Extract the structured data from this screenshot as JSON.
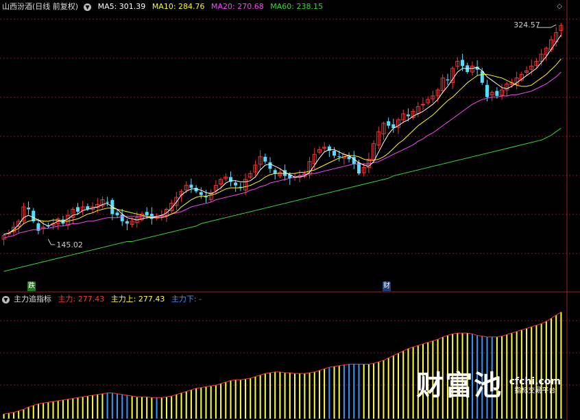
{
  "header": {
    "title": "山西汾酒(日线 前复权)",
    "ma5": "MA5: 301.39",
    "ma10": "MA10: 284.76",
    "ma20": "MA20: 270.68",
    "ma60": "MA60: 238.15"
  },
  "indicator_header": {
    "name": "主力追指标",
    "main": "主力: 277.43",
    "up": "主力上: 277.43",
    "down": "主力下: -"
  },
  "markers": {
    "left": "跌",
    "right": "财"
  },
  "watermark": {
    "big": "财富池",
    "site": "cfchi.com",
    "sub": "指标交易平台"
  },
  "colors": {
    "ma5": "#ffffff",
    "ma10": "#ffff00",
    "ma20": "#ff44ff",
    "ma60": "#33dd33",
    "up": "#ff3333",
    "down": "#55ddff",
    "bar_up": "#ffff33",
    "bar_down": "#3399ff",
    "grid": "#8a1a1a"
  },
  "chart_data": [
    {
      "type": "candlestick",
      "title": "山西汾酒(日线 前复权)",
      "annotations": [
        {
          "label": "324.57",
          "x": 112,
          "y": 324.57
        },
        {
          "label": "145.02",
          "x": 9,
          "y": 145.02
        }
      ],
      "ylim": [
        110,
        335
      ],
      "x_count": 114,
      "closes": [
        148,
        150,
        155,
        160,
        172,
        170,
        160,
        152,
        155,
        156,
        158,
        162,
        158,
        165,
        170,
        168,
        172,
        170,
        172,
        174,
        178,
        176,
        166,
        165,
        160,
        158,
        160,
        163,
        166,
        165,
        162,
        164,
        165,
        170,
        175,
        180,
        185,
        190,
        188,
        185,
        182,
        180,
        184,
        190,
        195,
        197,
        193,
        190,
        188,
        195,
        200,
        207,
        214,
        210,
        204,
        200,
        201,
        198,
        196,
        197,
        198,
        200,
        210,
        216,
        220,
        222,
        219,
        215,
        214,
        216,
        212,
        208,
        200,
        205,
        212,
        225,
        235,
        242,
        240,
        238,
        245,
        250,
        248,
        252,
        256,
        258,
        262,
        265,
        270,
        280,
        278,
        288,
        294,
        290,
        285,
        290,
        287,
        276,
        264,
        268,
        265,
        270,
        275,
        276,
        280,
        283,
        286,
        290,
        294,
        300,
        305,
        312,
        318,
        324
      ],
      "ma5": [
        149,
        150,
        153,
        157,
        163,
        165,
        163,
        161,
        158,
        156,
        158,
        160,
        160,
        162,
        165,
        166,
        169,
        170,
        171,
        172,
        174,
        175,
        172,
        170,
        166,
        163,
        162,
        161,
        162,
        163,
        163,
        164,
        165,
        167,
        171,
        176,
        182,
        185,
        187,
        187,
        186,
        184,
        183,
        185,
        188,
        192,
        194,
        194,
        193,
        193,
        194,
        197,
        203,
        207,
        208,
        206,
        204,
        201,
        199,
        197,
        197,
        198,
        201,
        207,
        213,
        218,
        220,
        220,
        218,
        216,
        215,
        212,
        209,
        207,
        206,
        210,
        218,
        226,
        233,
        238,
        240,
        243,
        245,
        248,
        250,
        252,
        255,
        258,
        262,
        268,
        273,
        279,
        285,
        288,
        288,
        288,
        289,
        286,
        281,
        278,
        275,
        272,
        271,
        273,
        276,
        279,
        282,
        285,
        288,
        293,
        298,
        304,
        310,
        316
      ],
      "ma10": [
        149,
        150,
        152,
        154,
        158,
        160,
        161,
        161,
        160,
        160,
        161,
        161,
        160,
        160,
        161,
        162,
        164,
        166,
        167,
        169,
        170,
        171,
        171,
        170,
        169,
        168,
        167,
        166,
        165,
        164,
        163,
        163,
        163,
        164,
        166,
        168,
        172,
        175,
        178,
        180,
        181,
        181,
        182,
        183,
        185,
        187,
        188,
        188,
        188,
        189,
        190,
        192,
        194,
        197,
        199,
        200,
        200,
        200,
        200,
        200,
        201,
        201,
        202,
        203,
        205,
        207,
        209,
        211,
        213,
        214,
        215,
        215,
        214,
        212,
        211,
        211,
        212,
        214,
        217,
        221,
        225,
        228,
        232,
        236,
        240,
        243,
        246,
        249,
        253,
        257,
        261,
        264,
        268,
        272,
        276,
        279,
        282,
        283,
        283,
        282,
        281,
        280,
        278,
        276,
        274,
        273,
        273,
        274,
        277,
        280,
        283,
        287,
        291,
        296
      ],
      "ma20": [
        146,
        147,
        148,
        150,
        151,
        152,
        153,
        153,
        154,
        154,
        155,
        156,
        156,
        157,
        158,
        158,
        159,
        160,
        160,
        161,
        162,
        163,
        163,
        163,
        164,
        164,
        164,
        164,
        164,
        164,
        164,
        164,
        164,
        165,
        166,
        167,
        168,
        170,
        172,
        173,
        174,
        175,
        176,
        178,
        179,
        180,
        181,
        182,
        183,
        184,
        186,
        187,
        189,
        190,
        192,
        193,
        194,
        195,
        196,
        197,
        198,
        199,
        200,
        200,
        201,
        202,
        203,
        204,
        205,
        206,
        207,
        208,
        208,
        208,
        208,
        209,
        210,
        212,
        214,
        216,
        218,
        220,
        222,
        224,
        227,
        229,
        232,
        234,
        237,
        240,
        243,
        246,
        249,
        252,
        255,
        258,
        260,
        262,
        263,
        264,
        264,
        265,
        265,
        266,
        266,
        267,
        268,
        269,
        271,
        273,
        275,
        278,
        281,
        285
      ],
      "ma60": [
        118,
        119,
        120,
        121,
        122,
        123,
        124,
        125,
        126,
        127,
        128,
        129,
        130,
        131,
        132,
        133,
        134,
        135,
        136,
        137,
        138,
        139,
        140,
        141,
        142,
        143,
        143,
        144,
        145,
        146,
        147,
        148,
        149,
        150,
        151,
        152,
        153,
        154,
        155,
        156,
        158,
        159,
        160,
        161,
        162,
        163,
        164,
        165,
        166,
        167,
        168,
        169,
        170,
        171,
        172,
        173,
        174,
        175,
        176,
        177,
        178,
        179,
        180,
        181,
        182,
        183,
        184,
        185,
        186,
        187,
        188,
        189,
        190,
        191,
        192,
        193,
        194,
        195,
        196,
        198,
        199,
        200,
        201,
        202,
        203,
        204,
        205,
        206,
        207,
        208,
        209,
        210,
        211,
        212,
        213,
        214,
        215,
        216,
        217,
        218,
        219,
        220,
        221,
        222,
        223,
        224,
        225,
        226,
        227,
        228,
        230,
        232,
        235,
        238
      ]
    },
    {
      "type": "bar",
      "title": "主力追指标",
      "series": [
        {
          "name": "主力上"
        },
        {
          "name": "主力下"
        }
      ],
      "values": [
        146,
        147,
        148,
        150,
        152,
        155,
        157,
        159,
        160,
        161,
        162,
        163,
        164,
        165,
        166,
        167,
        168,
        169,
        170,
        171,
        172,
        173,
        173,
        172,
        171,
        170,
        169,
        168,
        168,
        168,
        167,
        167,
        167,
        168,
        169,
        171,
        173,
        175,
        177,
        179,
        180,
        181,
        182,
        183,
        185,
        187,
        189,
        190,
        190,
        191,
        192,
        194,
        196,
        198,
        199,
        200,
        200,
        199,
        199,
        198,
        198,
        198,
        199,
        200,
        202,
        204,
        206,
        207,
        208,
        209,
        210,
        210,
        210,
        210,
        210,
        211,
        213,
        215,
        218,
        221,
        224,
        227,
        230,
        232,
        234,
        236,
        238,
        240,
        242,
        245,
        247,
        249,
        250,
        250,
        250,
        249,
        247,
        246,
        245,
        245,
        245,
        246,
        248,
        250,
        252,
        254,
        256,
        258,
        260,
        262,
        265,
        269,
        273,
        277
      ],
      "bar_state": [
        "u",
        "u",
        "u",
        "u",
        "u",
        "u",
        "u",
        "u",
        "u",
        "u",
        "u",
        "u",
        "u",
        "u",
        "u",
        "u",
        "u",
        "u",
        "u",
        "u",
        "u",
        "d",
        "d",
        "d",
        "d",
        "d",
        "u",
        "u",
        "u",
        "u",
        "u",
        "d",
        "u",
        "u",
        "u",
        "u",
        "u",
        "u",
        "u",
        "u",
        "u",
        "u",
        "u",
        "u",
        "u",
        "u",
        "u",
        "u",
        "u",
        "u",
        "u",
        "u",
        "u",
        "u",
        "u",
        "u",
        "u",
        "u",
        "u",
        "u",
        "u",
        "u",
        "u",
        "u",
        "u",
        "u",
        "d",
        "u",
        "u",
        "d",
        "d",
        "d",
        "d",
        "u",
        "u",
        "u",
        "u",
        "u",
        "u",
        "u",
        "u",
        "u",
        "u",
        "u",
        "u",
        "u",
        "u",
        "u",
        "u",
        "u",
        "u",
        "u",
        "u",
        "u",
        "u",
        "d",
        "d",
        "d",
        "d",
        "d",
        "u",
        "u",
        "u",
        "u",
        "u",
        "u",
        "u",
        "u",
        "u",
        "u",
        "u",
        "u",
        "u",
        "u"
      ],
      "ylim": [
        140,
        280
      ]
    }
  ]
}
